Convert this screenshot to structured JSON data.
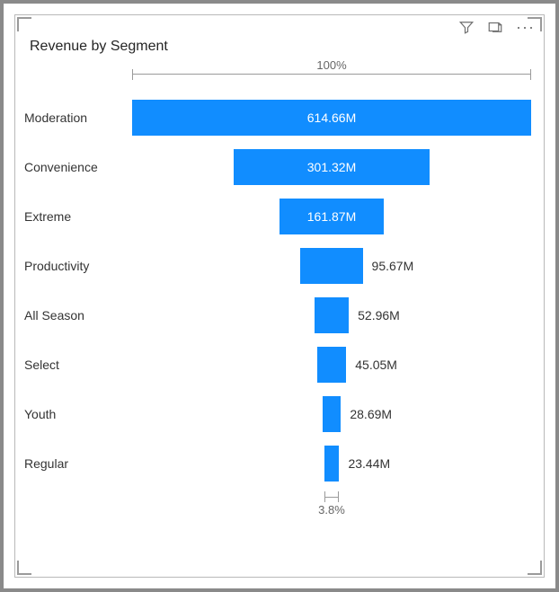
{
  "title": "Revenue by Segment",
  "top_pct_label": "100%",
  "bottom_pct_label": "3.8%",
  "chart_data": {
    "type": "bar",
    "orientation": "funnel",
    "title": "Revenue by Segment",
    "xlabel": "",
    "ylabel": "",
    "categories": [
      "Moderation",
      "Convenience",
      "Extreme",
      "Productivity",
      "All Season",
      "Select",
      "Youth",
      "Regular"
    ],
    "values": [
      614.66,
      301.32,
      161.87,
      95.67,
      52.96,
      45.05,
      28.69,
      23.44
    ],
    "value_unit": "M",
    "top_percent": 100,
    "bottom_percent": 3.8,
    "bar_color": "#118dff",
    "display_labels": [
      "614.66M",
      "301.32M",
      "161.87M",
      "95.67M",
      "52.96M",
      "45.05M",
      "28.69M",
      "23.44M"
    ]
  }
}
